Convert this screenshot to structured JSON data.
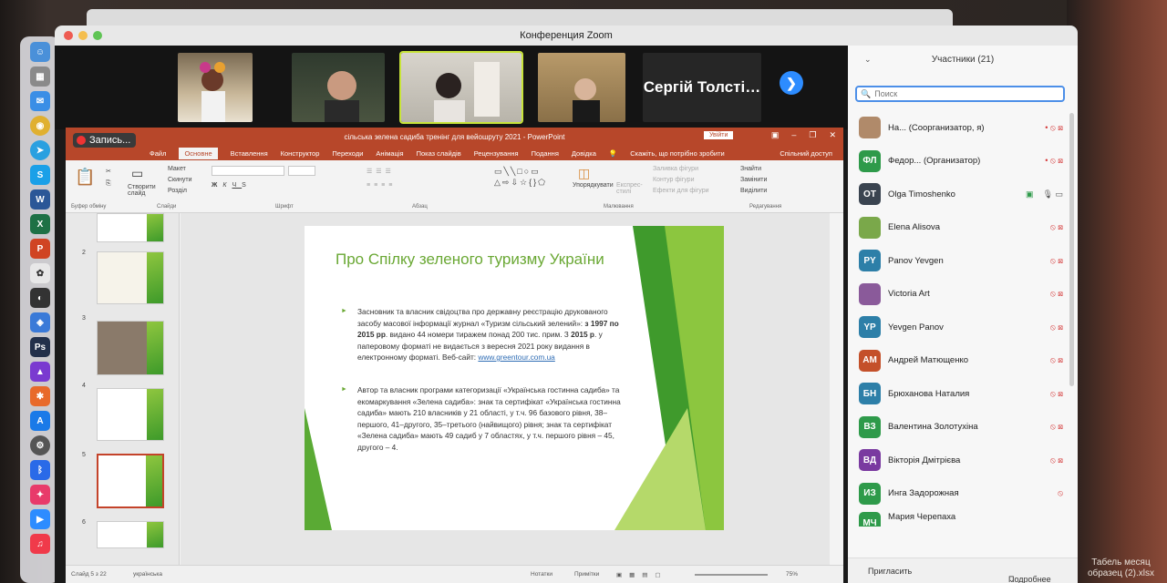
{
  "zoom": {
    "window_title": "Конференция Zoom",
    "gallery": {
      "name_tile": "Сергій Толсті…",
      "next_label": "❯"
    }
  },
  "recording": {
    "label": "Запись..."
  },
  "ppt": {
    "doc_title": "сільська зелена садиба тренінг для вейошруту 2021 - PowerPoint",
    "signin": "Увійти",
    "tabs": [
      "Файл",
      "Основне",
      "Вставлення",
      "Конструктор",
      "Переходи",
      "Анімація",
      "Показ слайдів",
      "Рецензування",
      "Подання",
      "Довідка"
    ],
    "tell_me": "Скажіть, що потрібно зробити",
    "share": "Спільний доступ",
    "ribbon": {
      "clipboard": "Буфер обміну",
      "create_slide": "Створити слайд",
      "layout": "Макет",
      "reset": "Скинути",
      "section": "Розділ",
      "slides": "Слайди",
      "font": "Шрифт",
      "paragraph": "Абзац",
      "arrange": "Упорядкувати",
      "quick_styles": "Експрес-стилі",
      "fill": "Заливка фігури",
      "outline": "Контур фігури",
      "effects": "Ефекти для фігури",
      "drawing": "Малювання",
      "find": "Знайти",
      "replace": "Замінити",
      "select": "Виділити",
      "editing": "Редагування"
    },
    "thumb_numbers": [
      "2",
      "3",
      "4",
      "5",
      "6"
    ],
    "slide": {
      "title": "Про Спілку зеленого туризму України",
      "bullet1_a": "Засновник та власник свідоцтва про державну реєстрацію друкованого засобу масової інформації журнал «Туризм сільський зелений»: ",
      "bullet1_b": "з 1997 по 2015 рр",
      "bullet1_c": ". видано 44 номери тиражем понад 200 тис. прим. З ",
      "bullet1_d": "2015 р",
      "bullet1_e": ". у паперовому форматі не видається з вересня 2021 року видання в електронному форматі. Веб-сайт: ",
      "link": "www.greentour.com.ua",
      "bullet2": "Автор та власник програми категоризації «Українська гостинна садиба» та екомаркування «Зелена садиба»: знак та сертифікат «Українська гостинна садиба» мають 210 власників у 21 області, у т.ч. 96 базового рівня, 38– першого, 41–другого, 35–третього (найвищого) рівня; знак та сертифікат «Зелена садиба» мають 49 садиб у 7 областях, у т.ч. першого рівня – 45, другого – 4."
    },
    "status": {
      "slide_info": "Слайд 5 з 22",
      "language": "українська",
      "notes": "Нотатки",
      "comments": "Примітки",
      "zoom": "75%"
    }
  },
  "participants": {
    "header": "Участники (21)",
    "search_placeholder": "Поиск",
    "list": [
      {
        "initials": "",
        "name": "На...  (Соорганизатор, я)",
        "color": "#b08a6a"
      },
      {
        "initials": "ФЛ",
        "name": "Федор...  (Организатор)",
        "color": "#2e9a4a"
      },
      {
        "initials": "OT",
        "name": "Olga Timoshenko",
        "color": "#3a4450"
      },
      {
        "initials": "",
        "name": "Elena Alisova",
        "color": "#7aa84a"
      },
      {
        "initials": "PY",
        "name": "Panov Yevgen",
        "color": "#2d7fa8"
      },
      {
        "initials": "",
        "name": "Victoria Art",
        "color": "#8a5a9a"
      },
      {
        "initials": "YP",
        "name": "Yevgen Panov",
        "color": "#2d7fa8"
      },
      {
        "initials": "АМ",
        "name": "Андрей Матющенко",
        "color": "#c4502a"
      },
      {
        "initials": "БН",
        "name": "Брюханова Наталия",
        "color": "#2d7fa8"
      },
      {
        "initials": "ВЗ",
        "name": "Валентина Золотухіна",
        "color": "#2e9a4a"
      },
      {
        "initials": "ВД",
        "name": "Вікторія Дмітрієва",
        "color": "#7a3aa0"
      },
      {
        "initials": "ИЗ",
        "name": "Инга Задорожная",
        "color": "#2e9a4a"
      },
      {
        "initials": "МЧ",
        "name": "Мария Черепаха",
        "color": "#2e9a4a"
      }
    ],
    "invite": "Пригласить",
    "more": "Подробнее"
  },
  "desktop": {
    "file_label_1": "Табель месяц",
    "file_label_2": "образец (2).xlsx"
  },
  "colors": {
    "ppt_red": "#b7472a",
    "zoom_blue": "#2d8cff",
    "slide_green": "#6aa834"
  }
}
